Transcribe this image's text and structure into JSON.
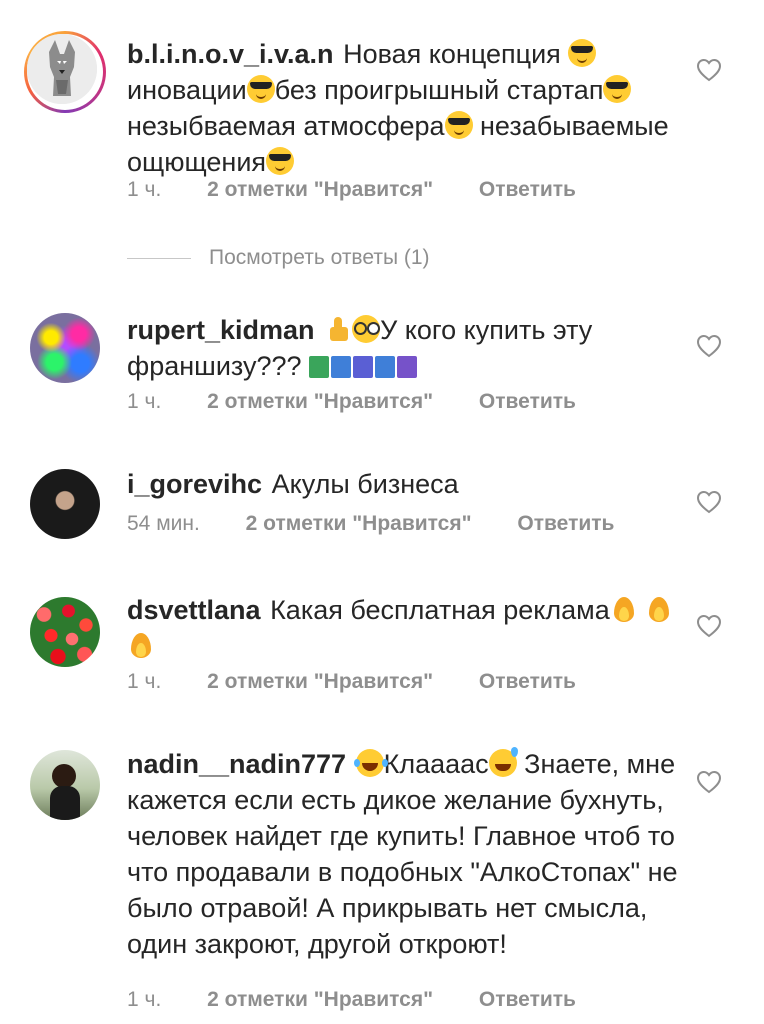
{
  "comments": [
    {
      "username": "b.l.i.n.o.v_i.v.a.n",
      "text_parts": [
        "Новая концепция",
        "иновации",
        "без проигрышный стартап",
        "незыбваемая атмосфера",
        "незабываемые ощющения"
      ],
      "time": "1 ч.",
      "likes": "2 отметки \"Нравится\"",
      "reply_label": "Ответить",
      "view_replies": "Посмотреть ответы (1)"
    },
    {
      "username": "rupert_kidman",
      "text_parts": [
        "У кого купить эту франшизу???"
      ],
      "time": "1 ч.",
      "likes": "2 отметки \"Нравится\"",
      "reply_label": "Ответить"
    },
    {
      "username": "i_gorevihc",
      "text_parts": [
        "Акулы бизнеса"
      ],
      "time": "54 мин.",
      "likes": "2 отметки \"Нравится\"",
      "reply_label": "Ответить"
    },
    {
      "username": "dsvettlana",
      "text_parts": [
        "Какая бесплатная реклама"
      ],
      "time": "1 ч.",
      "likes": "2 отметки \"Нравится\"",
      "reply_label": "Ответить"
    },
    {
      "username": "nadin__nadin777",
      "text_parts": [
        "Клаааас",
        "Знаете, мне кажется если есть дикое желание бухнуть, человек найдет где купить! Главное чтоб то что продавали в подобных \"АлкоСтопах\" не было отравой! А прикрывать нет смысла, один закроют, другой откроют!"
      ],
      "time": "1 ч.",
      "likes": "2 отметки \"Нравится\"",
      "reply_label": "Ответить"
    }
  ],
  "icons": {
    "like": "heart-icon",
    "avatar_story_ring": "story-ring"
  },
  "colors": {
    "text": "#262626",
    "meta": "#8e8e8e",
    "divider": "#c7c7c7"
  }
}
